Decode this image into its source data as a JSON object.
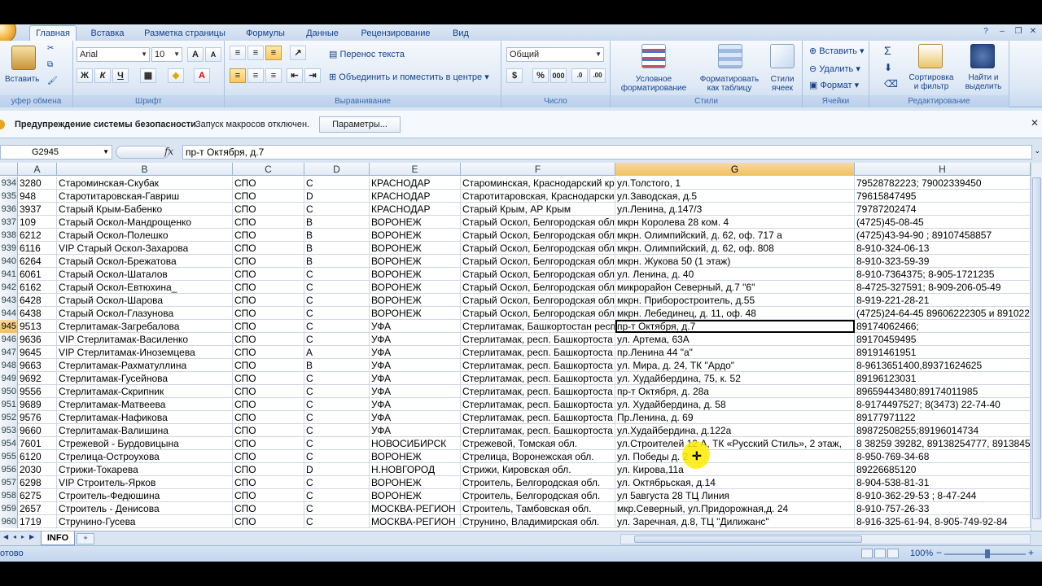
{
  "tabs": [
    "Главная",
    "Вставка",
    "Разметка страницы",
    "Формулы",
    "Данные",
    "Рецензирование",
    "Вид"
  ],
  "ribbon": {
    "clipboard": {
      "paste": "Вставить",
      "label": "уфер обмена"
    },
    "font": {
      "name": "Arial",
      "size": "10",
      "bold": "Ж",
      "italic": "К",
      "underline": "Ч",
      "label": "Шрифт"
    },
    "alignment": {
      "wrap": "Перенос текста",
      "merge": "Объединить и поместить в центре",
      "label": "Выравнивание"
    },
    "number": {
      "format": "Общий",
      "label": "Число",
      "percent": "%",
      "thousands": "000"
    },
    "styles": {
      "conditional_1": "Условное",
      "conditional_2": "форматирование",
      "table_1": "Форматировать",
      "table_2": "как таблицу",
      "cell_1": "Стили",
      "cell_2": "ячеек",
      "label": "Стили"
    },
    "cells": {
      "insert": "Вставить",
      "delete": "Удалить",
      "format": "Формат",
      "label": "Ячейки"
    },
    "editing": {
      "sum": "Σ",
      "sort_1": "Сортировка",
      "sort_2": "и фильтр",
      "find_1": "Найти и",
      "find_2": "выделить",
      "label": "Редактирование"
    }
  },
  "security": {
    "title": "Предупреждение системы безопасности",
    "message": "Запуск макросов отключен.",
    "button": "Параметры..."
  },
  "formula": {
    "cell": "G2945",
    "fx": "fx",
    "value": "пр-т Октября, д.7"
  },
  "columns": [
    "A",
    "B",
    "C",
    "D",
    "E",
    "F",
    "G",
    "H"
  ],
  "rows": [
    {
      "n": "934",
      "a": "3280",
      "b": "Староминская-Скубак",
      "c": "СПО",
      "d": "С",
      "e": "КРАСНОДАР",
      "f": "Староминская, Краснодарский кр",
      "g": "ул.Толстого, 1",
      "h": "79528782223; 79002339450"
    },
    {
      "n": "935",
      "a": "948",
      "b": "Старотитаровская-Гавриш",
      "c": "СПО",
      "d": "D",
      "e": "КРАСНОДАР",
      "f": "Старотитаровская, Краснодарский",
      "g": "ул.Заводская, д.5",
      "h": "79615847495"
    },
    {
      "n": "936",
      "a": "3937",
      "b": "Старый Крым-Бабенко",
      "c": "СПО",
      "d": "С",
      "e": "КРАСНОДАР",
      "f": "Старый Крым, АР Крым",
      "g": "ул.Ленина, д.147/3",
      "h": "79787202474"
    },
    {
      "n": "937",
      "a": "109",
      "b": "Старый Оскол-Мандрощенко",
      "c": "СПО",
      "d": "В",
      "e": "ВОРОНЕЖ",
      "f": "Старый Оскол, Белгородская обл",
      "g": "мкрн Королева 28 ком. 4",
      "h": "(4725)45-08-45"
    },
    {
      "n": "938",
      "a": "6212",
      "b": "Старый Оскол-Полешко",
      "c": "СПО",
      "d": "В",
      "e": "ВОРОНЕЖ",
      "f": "Старый Оскол, Белгородская обл",
      "g": "мкрн. Олимпийский, д. 62, оф. 717 а",
      "h": "(4725)43-94-90 ; 89107458857"
    },
    {
      "n": "939",
      "a": "6116",
      "b": "VIP Старый Оскол-Захарова",
      "c": "СПО",
      "d": "В",
      "e": "ВОРОНЕЖ",
      "f": "Старый Оскол, Белгородская обл",
      "g": "мкрн. Олимпийский, д. 62, оф. 808",
      "h": "8-910-324-06-13"
    },
    {
      "n": "940",
      "a": "6264",
      "b": "Старый Оскол-Брежатова",
      "c": "СПО",
      "d": "В",
      "e": "ВОРОНЕЖ",
      "f": "Старый Оскол, Белгородская обл",
      "g": "мкрн. Жукова 50 (1 этаж)",
      "h": "8-910-323-59-39"
    },
    {
      "n": "941",
      "a": "6061",
      "b": "Старый Оскол-Шаталов",
      "c": "СПО",
      "d": "С",
      "e": "ВОРОНЕЖ",
      "f": "Старый Оскол, Белгородская обл",
      "g": "ул. Ленина, д. 40",
      "h": "8-910-7364375; 8-905-1721235"
    },
    {
      "n": "942",
      "a": "6162",
      "b": "Старый Оскол-Евтюхина_",
      "c": "СПО",
      "d": "С",
      "e": "ВОРОНЕЖ",
      "f": "Старый Оскол, Белгородская обл",
      "g": "микрорайон Северный, д.7 \"6\"",
      "h": "8-4725-327591; 8-909-206-05-49"
    },
    {
      "n": "943",
      "a": "6428",
      "b": "Старый Оскол-Шарова",
      "c": "СПО",
      "d": "С",
      "e": "ВОРОНЕЖ",
      "f": "Старый Оскол, Белгородская обл",
      "g": "мкрн. Приборостроитель, д.55",
      "h": "8-919-221-28-21"
    },
    {
      "n": "944",
      "a": "6438",
      "b": "Старый Оскол-Глазунова",
      "c": "СПО",
      "d": "С",
      "e": "ВОРОНЕЖ",
      "f": "Старый Оскол, Белгородская обл",
      "g": "мкрн. Лебединец, д. 11, оф. 48",
      "h": "(4725)24-64-45 89606222305 и 891022"
    },
    {
      "n": "945",
      "a": "9513",
      "b": "Стерлитамак-Загребалова",
      "c": "СПО",
      "d": "С",
      "e": "УФА",
      "f": "Стерлитамак, Башкортостан респ",
      "g": "пр-т Октября, д.7",
      "h": "89174062466;"
    },
    {
      "n": "946",
      "a": "9636",
      "b": "VIP Стерлитамак-Василенко",
      "c": "СПО",
      "d": "С",
      "e": "УФА",
      "f": "Стерлитамак, респ. Башкортоста",
      "g": "ул. Артема, 63А",
      "h": "89170459495"
    },
    {
      "n": "947",
      "a": "9645",
      "b": "VIP Стерлитамак-Иноземцева",
      "c": "СПО",
      "d": "А",
      "e": "УФА",
      "f": "Стерлитамак, респ. Башкортоста",
      "g": "пр.Ленина 44 \"а\"",
      "h": "89191461951"
    },
    {
      "n": "948",
      "a": "9663",
      "b": "Стерлитамак-Рахматуллина",
      "c": "СПО",
      "d": "В",
      "e": "УФА",
      "f": "Стерлитамак, респ. Башкортоста",
      "g": "ул. Мира, д. 24, ТК \"Ардо\"",
      "h": "8-9613651400,89371624625"
    },
    {
      "n": "949",
      "a": "9692",
      "b": "Стерлитамак-Гусейнова",
      "c": "СПО",
      "d": "С",
      "e": "УФА",
      "f": "Стерлитамак, респ. Башкортоста",
      "g": "ул. Худайбердина, 75, к. 52",
      "h": "89196123031"
    },
    {
      "n": "950",
      "a": "9556",
      "b": "Стерлитамак-Скрипник",
      "c": "СПО",
      "d": "С",
      "e": "УФА",
      "f": "Стерлитамак, респ. Башкортоста",
      "g": "пр-т Октября, д. 28а",
      "h": "89659443480;89174011985"
    },
    {
      "n": "951",
      "a": "9689",
      "b": "Стерлитамак-Матвеева",
      "c": "СПО",
      "d": "С",
      "e": "УФА",
      "f": "Стерлитамак, респ. Башкортоста",
      "g": "ул. Худайбердина, д. 58",
      "h": "8-9174497527; 8(3473) 22-74-40"
    },
    {
      "n": "952",
      "a": "9576",
      "b": "Стерлитамак-Нафикова",
      "c": "СПО",
      "d": "С",
      "e": "УФА",
      "f": "Стерлитамак, респ. Башкортоста",
      "g": "Пр.Ленина, д. 69",
      "h": "89177971122"
    },
    {
      "n": "953",
      "a": "9660",
      "b": "Стерлитамак-Валишина",
      "c": "СПО",
      "d": "С",
      "e": "УФА",
      "f": "Стерлитамак, респ. Башкортоста",
      "g": "ул.Худайбердина, д.122а",
      "h": "89872508255;89196014734"
    },
    {
      "n": "954",
      "a": "7601",
      "b": "Стрежевой - Бурдовицына",
      "c": "СПО",
      "d": "С",
      "e": "НОВОСИБИРСК",
      "f": "Стрежевой, Томская обл.",
      "g": " ул.Строителей 12 А, ТК «Русский Стиль», 2 этаж,",
      "h": "8 38259 39282, 89138254777, 8913845"
    },
    {
      "n": "955",
      "a": "6120",
      "b": "Стрелица-Остроухова",
      "c": "СПО",
      "d": "С",
      "e": "ВОРОНЕЖ",
      "f": "Стрелица, Воронежская обл.",
      "g": "ул. Победы д. 2",
      "h": "8-950-769-34-68"
    },
    {
      "n": "956",
      "a": "2030",
      "b": "Стрижи-Токарева",
      "c": "СПО",
      "d": "D",
      "e": "Н.НОВГОРОД",
      "f": "Стрижи, Кировская обл.",
      "g": "ул. Кирова,11а",
      "h": "89226685120"
    },
    {
      "n": "957",
      "a": "6298",
      "b": "VIP Строитель-Ярков",
      "c": "СПО",
      "d": "С",
      "e": "ВОРОНЕЖ",
      "f": "Строитель, Белгородская обл.",
      "g": "ул. Октябрьская, д.14",
      "h": "8-904-538-81-31"
    },
    {
      "n": "958",
      "a": "6275",
      "b": "Строитель-Федюшина",
      "c": "СПО",
      "d": "С",
      "e": "ВОРОНЕЖ",
      "f": "Строитель, Белгородская обл.",
      "g": "ул 5августа 28 ТЦ Линия",
      "h": "8-910-362-29-53 ; 8-47-244"
    },
    {
      "n": "959",
      "a": "2657",
      "b": "Строитель - Денисова",
      "c": "СПО",
      "d": "С",
      "e": "МОСКВА-РЕГИОН",
      "f": "Строитель, Тамбовская обл.",
      "g": "мкр.Северный, ул.Придорожная,д. 24",
      "h": "8-910-757-26-33"
    },
    {
      "n": "960",
      "a": "1719",
      "b": "Струнино-Гусева",
      "c": "СПО",
      "d": "С",
      "e": "МОСКВА-РЕГИОН",
      "f": "Струнино, Владимирская обл.",
      "g": "ул. Заречная, д.8, ТЦ \"Дилижанс\"",
      "h": "8-916-325-61-94, 8-905-749-92-84"
    }
  ],
  "sheet": {
    "name": "INFO"
  },
  "status": {
    "ready": "отово",
    "zoom": "100%"
  }
}
